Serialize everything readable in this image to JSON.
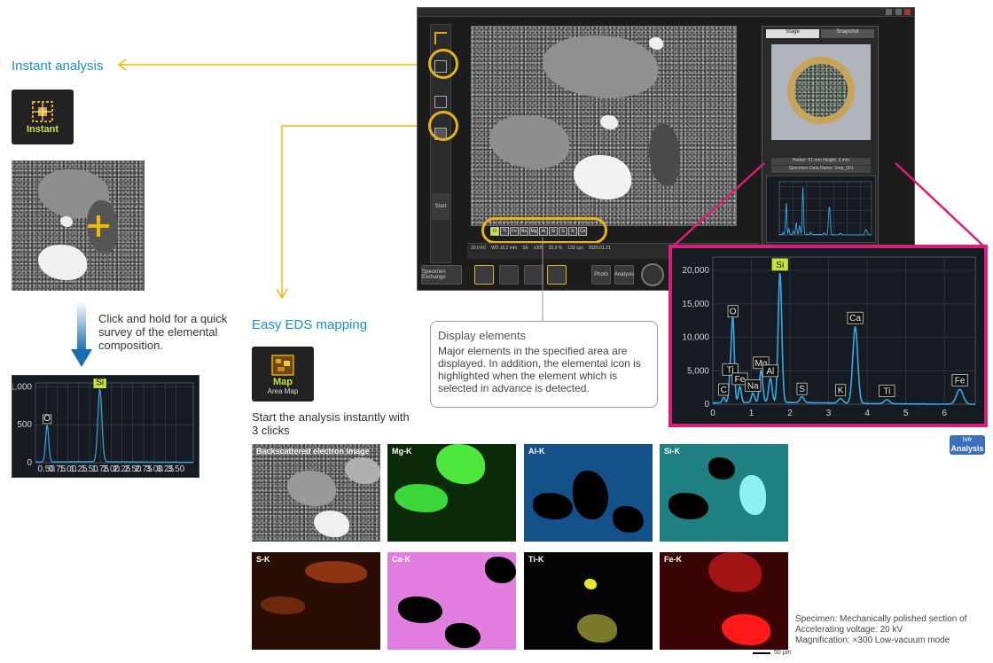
{
  "instant": {
    "heading": "Instant analysis",
    "tile_label": "Instant",
    "description": "Click and hold for a quick survey of the elemental composition."
  },
  "mapping": {
    "heading": "Easy EDS mapping",
    "tile_label": "Map",
    "tile_sub": "Area Map",
    "description": "Start the analysis instantly with 3 clicks"
  },
  "maps": [
    {
      "label": "Backscattered electron image",
      "color": "#8a8a8a"
    },
    {
      "label": "Mg-K",
      "color": "#3bd63a"
    },
    {
      "label": "Al-K",
      "color": "#1f78c8"
    },
    {
      "label": "Si-K",
      "color": "#35c8c8"
    },
    {
      "label": "S-K",
      "color": "#d8541c"
    },
    {
      "label": "Ca-K",
      "color": "#e27ee0"
    },
    {
      "label": "Ti-K",
      "color": "#d8d82a"
    },
    {
      "label": "Fe-K",
      "color": "#e01a1a"
    }
  ],
  "scale_bar": "50 μm",
  "specimen": {
    "line1": "Specimen: Mechanically polished section of",
    "line2": "Accelerating voltage: 20 kV",
    "line3": "Magnification: ×300 Low-vacuum mode"
  },
  "callout": {
    "title": "Display elements",
    "body": "Major elements in the specified area are displayed. In addition, the elemental icon is highlighted when the element which is selected in advance is detected."
  },
  "live_badge": {
    "line1": "ive",
    "line2": "Analysis"
  },
  "app": {
    "tabs": [
      "Stage",
      "Snapshot"
    ],
    "start_label": "Start",
    "element_chips": [
      "O",
      "Ti",
      "Fe",
      "Na",
      "Mg",
      "Al",
      "Si",
      "S",
      "K",
      "Ca",
      "Ti",
      "Fe"
    ],
    "status_fields": [
      "20.0 kV",
      "WD 10.2 mm",
      "SE",
      "x300",
      "33.9 %",
      "133 cps",
      "2020.01.21"
    ],
    "toolbar": [
      "Specimen Exchange",
      "Photo",
      "Analysis"
    ],
    "holder_info": "Holder: 51 mm    Height: 3 mm",
    "specimen_info": "Specimen Data Name: Smp_001"
  },
  "chart_data": [
    {
      "type": "line",
      "title": "",
      "xlabel": "",
      "ylabel": "",
      "xlim": [
        0,
        6.8
      ],
      "ylim": [
        0,
        22000
      ],
      "x_ticks": [
        "0",
        "1",
        "2",
        "3",
        "4",
        "5",
        "6"
      ],
      "y_ticks": [
        "0",
        "5,000",
        "10,000",
        "15,000",
        "20,000"
      ],
      "peaks": [
        {
          "element": "C",
          "x": 0.28,
          "y": 800
        },
        {
          "element": "O",
          "x": 0.52,
          "y": 12500
        },
        {
          "element": "Ti",
          "x": 0.45,
          "y": 3800
        },
        {
          "element": "Fe",
          "x": 0.7,
          "y": 2400
        },
        {
          "element": "Na",
          "x": 1.04,
          "y": 1400
        },
        {
          "element": "Mg",
          "x": 1.25,
          "y": 4800
        },
        {
          "element": "Al",
          "x": 1.49,
          "y": 3600
        },
        {
          "element": "Si",
          "x": 1.74,
          "y": 19500
        },
        {
          "element": "S",
          "x": 2.31,
          "y": 900
        },
        {
          "element": "K",
          "x": 3.31,
          "y": 700
        },
        {
          "element": "Ca",
          "x": 3.69,
          "y": 11500
        },
        {
          "element": "Ti",
          "x": 4.51,
          "y": 600
        },
        {
          "element": "Fe",
          "x": 6.4,
          "y": 2200
        }
      ],
      "highlighted": "Si",
      "grid": true
    },
    {
      "type": "line",
      "title": "",
      "xlabel": "",
      "ylabel": "",
      "xlim": [
        0.25,
        3.9
      ],
      "ylim": [
        0,
        1050
      ],
      "x_ticks": [
        "0.50",
        "0.75",
        "1.00",
        "1.25",
        "1.50",
        "1.75",
        "2.00",
        "2.25",
        "2.50",
        "2.75",
        "3.00",
        "3.25",
        "3.50"
      ],
      "y_ticks": [
        "0",
        "500",
        "1,000"
      ],
      "peaks": [
        {
          "element": "O",
          "x": 0.52,
          "y": 480
        },
        {
          "element": "Si",
          "x": 1.74,
          "y": 950
        }
      ],
      "highlighted": "Si",
      "grid": true
    }
  ]
}
